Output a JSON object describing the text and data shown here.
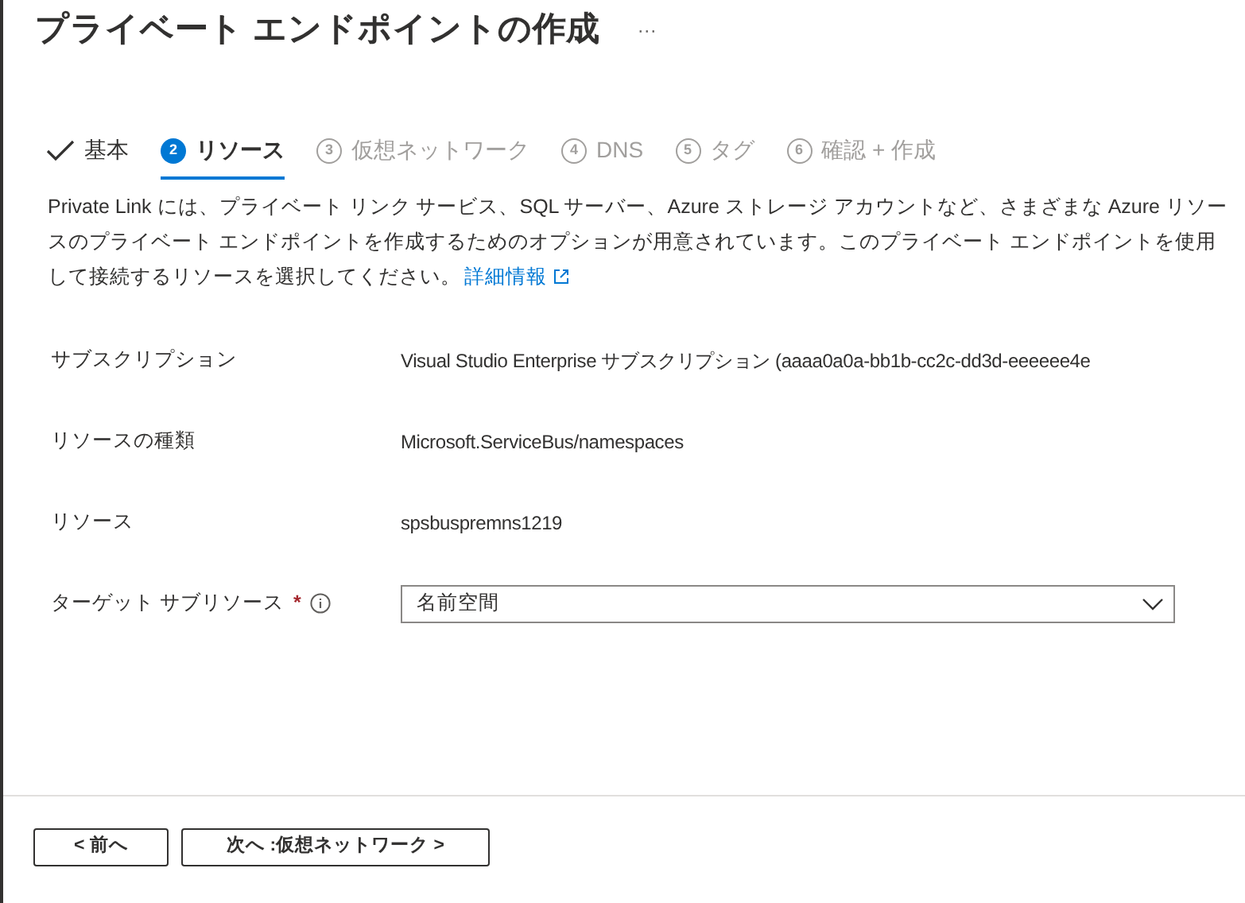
{
  "header": {
    "title": "プライベート エンドポイントの作成",
    "more": "···"
  },
  "steps": [
    {
      "kind": "done",
      "label": "基本",
      "selected": false,
      "disabled": false
    },
    {
      "kind": "step",
      "number": "2",
      "label": "リソース",
      "selected": true,
      "disabled": false
    },
    {
      "kind": "step",
      "number": "3",
      "label": "仮想ネットワーク",
      "selected": false,
      "disabled": true
    },
    {
      "kind": "step",
      "number": "4",
      "label": "DNS",
      "selected": false,
      "disabled": true
    },
    {
      "kind": "step",
      "number": "5",
      "label": "タグ",
      "selected": false,
      "disabled": true
    },
    {
      "kind": "step",
      "number": "6",
      "label": "確認 + 作成",
      "selected": false,
      "disabled": true
    }
  ],
  "description": {
    "text": "Private Link には、プライベート リンク サービス、SQL サーバー、Azure ストレージ アカウントなど、さまざまな Azure リソースのプライベート エンドポイントを作成するためのオプションが用意されています。このプライベート エンドポイントを使用して接続するリソースを選択してください。",
    "link": "詳細情報"
  },
  "fields": [
    {
      "kind": "text",
      "label": "サブスクリプション",
      "value": "Visual Studio Enterprise サブスクリプション (aaaa0a0a-bb1b-cc2c-dd3d-eeeeee4e"
    },
    {
      "kind": "text",
      "label": "リソースの種類",
      "value": "Microsoft.ServiceBus/namespaces"
    },
    {
      "kind": "text",
      "label": "リソース",
      "value": "spsbuspremns1219"
    },
    {
      "kind": "dropdown",
      "label": "ターゲット サブリソース",
      "value": "名前空間",
      "required_marker": "*",
      "info": true
    }
  ],
  "footer": {
    "buttons": [
      "< 前へ",
      "次へ :仮想ネットワーク >"
    ]
  }
}
